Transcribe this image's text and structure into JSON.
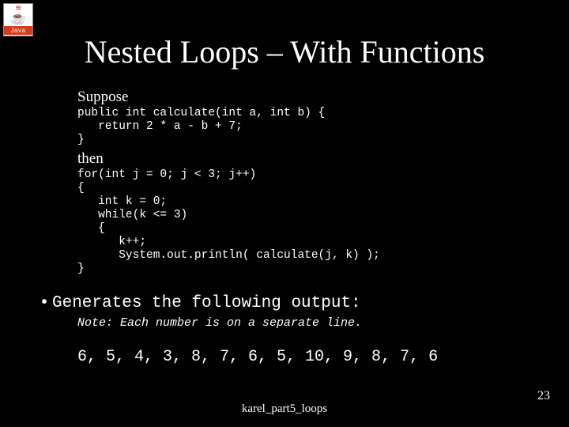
{
  "logo": {
    "brand": "Java"
  },
  "title": "Nested Loops – With Functions",
  "suppose_label": "Suppose",
  "code_calculate": "public int calculate(int a, int b) {\n   return 2 * a - b + 7;\n}",
  "then_label": "then",
  "code_loop": "for(int j = 0; j < 3; j++)\n{\n   int k = 0;\n   while(k <= 3)\n   {\n      k++;\n      System.out.println( calculate(j, k) );\n}",
  "bullet": "Generates the following output:",
  "note": "Note: Each number is on a separate line.",
  "output_sequence": "6, 5, 4, 3, 8, 7, 6, 5, 10, 9, 8, 7, 6",
  "footer": "karel_part5_loops",
  "page_number": "23"
}
